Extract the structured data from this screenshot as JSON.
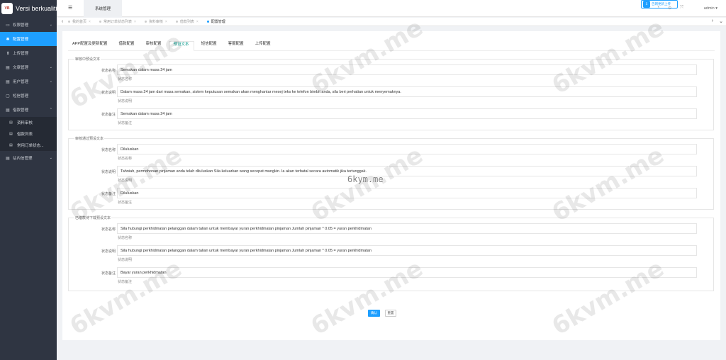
{
  "app": {
    "title": "Versi berkualiti",
    "logo_text": "VB"
  },
  "sidebar": {
    "items": [
      {
        "icon": "▭",
        "label": "权限管理",
        "chev": "⌄"
      },
      {
        "icon": "✱",
        "label": "配置管理"
      },
      {
        "icon": "⬆",
        "label": "上传管理"
      },
      {
        "icon": "▤",
        "label": "文章管理",
        "chev": "⌄"
      },
      {
        "icon": "▤",
        "label": "用户管理",
        "chev": "⌄"
      },
      {
        "icon": "▢",
        "label": "短信管理"
      },
      {
        "icon": "▤",
        "label": "借款管理",
        "chev": "⌃"
      }
    ],
    "sub_items": [
      {
        "icon": "▤",
        "label": "资料审核"
      },
      {
        "icon": "▤",
        "label": "借款列表"
      },
      {
        "icon": "▤",
        "label": "常用订单状态..."
      }
    ],
    "last_item": {
      "icon": "▤",
      "label": "站内信管理",
      "chev": "⌄"
    }
  },
  "topbar": {
    "menu_icon": "☰",
    "tab": "系统管理",
    "download_label": "告网更新上传",
    "download_icon": "⇩",
    "icons": [
      "◔",
      "⊙",
      "⤧"
    ],
    "admin": "admin ▾"
  },
  "tabbar": {
    "left_arrow": "‹",
    "right_arrows": [
      "›",
      "⌄"
    ],
    "tabs": [
      {
        "label": "我的首页",
        "x": "×"
      },
      {
        "label": "常用订单状态列表",
        "x": "×"
      },
      {
        "label": "资料审核",
        "x": "×"
      },
      {
        "label": "借款列表",
        "x": "×"
      },
      {
        "label": "配置管理",
        "x": ""
      }
    ]
  },
  "subtabs": [
    "APP配置及更新配置",
    "借款配置",
    "审核配置",
    "预设文本",
    "短信配置",
    "客服配置",
    "上传配置"
  ],
  "groups": [
    {
      "legend": "审核中预设文本",
      "rows": [
        {
          "label": "状态名称",
          "value": "Semakan dalam masa 24 jam",
          "hint": "状态名称"
        },
        {
          "label": "状态说明",
          "value": "Dalam masa 24 jam dari masa semakan, sistem keputusan semakan akan menghantar mesej teks ke telefon bimbit anda, sila beri perhatian untuk menyemaknya.",
          "hint": "状态说明"
        },
        {
          "label": "状态备注",
          "value": "Semakan dalam masa 24 jam",
          "hint": "状态备注"
        }
      ]
    },
    {
      "legend": "审核通过预设文本",
      "rows": [
        {
          "label": "状态名称",
          "value": "Diluluskan",
          "hint": "状态名称"
        },
        {
          "label": "状态说明",
          "value": "Tahniah, permohonan pinjaman anda telah diluluskan Sila keluarkan wang secepat mungkin. la akan terbatal secara automatik jika tertunggak.",
          "hint": "状态说明"
        },
        {
          "label": "状态备注",
          "value": "Diluluskan",
          "hint": "状态备注"
        }
      ]
    },
    {
      "legend": "已借款待下载预设文本",
      "rows": [
        {
          "label": "状态名称",
          "value": "Sila hubungi perkhidmatan pelanggan dalam talian untuk membayar yuran perkhidmatan pinjaman Jumlah pinjaman * 0.05 = yuran perkhidmatan",
          "hint": "状态名称"
        },
        {
          "label": "状态说明",
          "value": "Sila hubungi perkhidmatan pelanggan dalam talian untuk membayar yuran perkhidmatan pinjaman Jumlah pinjaman * 0.05 = yuran perkhidmatan",
          "hint": "状态说明"
        },
        {
          "label": "状态备注",
          "value": "Bayar yuran perkhidmatan",
          "hint": "状态备注"
        }
      ]
    }
  ],
  "buttons": {
    "confirm": "确认",
    "reset": "重置"
  },
  "watermark": "6kvm.me",
  "watermark_small": "6kym.me"
}
